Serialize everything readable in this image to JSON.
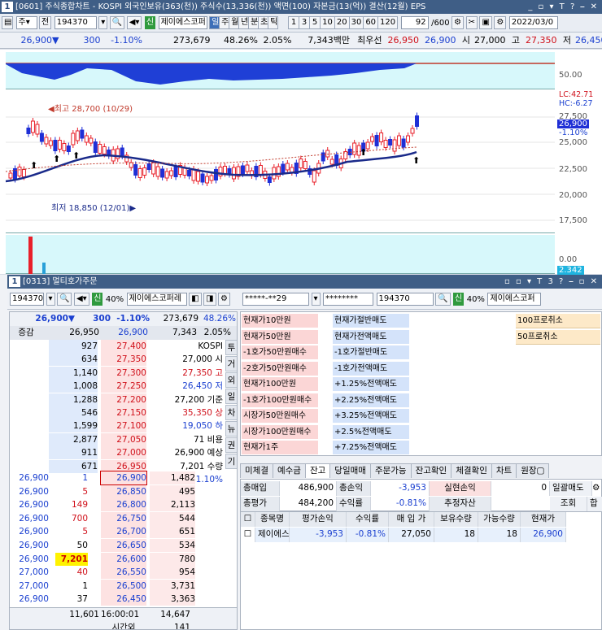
{
  "chart_window": {
    "num": "1",
    "title": "[0601] 주식종합차트 - KOSPI 외국인보유(363(천)) 주식수(13,336(천)) 액면(100) 자본금(13(억)) 결산(12월) EPS",
    "controls": "_ ▫ ▾ T ? ⎯ ✕"
  },
  "toolbar": {
    "mode": "주▾",
    "full": "전",
    "code": "194370",
    "green": "신",
    "name": "제이에스코퍼",
    "period_tabs": [
      "일",
      "주",
      "월",
      "년",
      "분",
      "초",
      "틱"
    ],
    "intervals": [
      "1",
      "3",
      "5",
      "10",
      "20",
      "30",
      "60",
      "120"
    ],
    "count": "92",
    "count_total": "/600",
    "date": "2022/03/0"
  },
  "quote": {
    "price": "26,900",
    "change": "300",
    "rate": "-1.10%",
    "volume": "273,679",
    "vol_rate": "48.26%",
    "turnover": "2.05%",
    "amount": "7,343백만",
    "best_label": "최우선",
    "bid": "26,950",
    "ask": "26,900",
    "open_label": "시",
    "open": "27,000",
    "high_label": "고",
    "high": "27,350",
    "low_label": "저",
    "low": "26,450",
    "sell_btn": "매수"
  },
  "chart_data": {
    "type": "candlestick",
    "upper_axis": [
      "50.00"
    ],
    "price_axis": [
      "27,500",
      "25,000",
      "22,500",
      "20,000",
      "17,500"
    ],
    "lower_axis": [
      "0.00",
      "2.342"
    ],
    "lc": "LC:42.71",
    "hc": "HC:-6.27",
    "last_price": "26,900",
    "last_rate": "-1.10%",
    "high_note": "최고 28,700 (10/29)",
    "low_note": "최저 18,850 (12/01)",
    "colors": {
      "up": "#e8202a",
      "down": "#1f2fd6",
      "ma": "#1a2a8a",
      "ma2": "#c0392b"
    }
  },
  "order_window": {
    "num": "1",
    "title": "[0313] 멀티호가주문",
    "controls": "▫ ▫ ▾ T 3 ? ⎯ ▫ ✕",
    "code": "194370",
    "green": "신",
    "margin": "40%",
    "name": "제이에스코퍼레",
    "account": "*****-**29",
    "password": "********",
    "code2": "194370",
    "green2": "신",
    "margin2": "40%",
    "name2": "제이에스코퍼"
  },
  "orderbook": {
    "price": "26,900▼",
    "change": "300",
    "rate": "-1.10%",
    "volume": "273,679",
    "vol_rate": "48.26%",
    "sub_label": "증감",
    "sub_bid": "26,950",
    "sub_ask": "26,900",
    "sub_amount": "7,343",
    "sub_rate": "2.05%",
    "sell_rows": [
      {
        "qty": "927",
        "price": "27,400",
        "info": "KOSPI"
      },
      {
        "qty": "634",
        "price": "27,350",
        "info": "27,000 시"
      },
      {
        "qty": "1,140",
        "price": "27,300",
        "info": "27,350 고"
      },
      {
        "qty": "1,008",
        "price": "27,250",
        "info": "26,450 저"
      },
      {
        "qty": "1,288",
        "price": "27,200",
        "info": "27,200 기준"
      },
      {
        "qty": "546",
        "price": "27,150",
        "info": "35,350 상"
      },
      {
        "qty": "1,599",
        "price": "27,100",
        "info": "19,050 하"
      },
      {
        "qty": "2,877",
        "price": "27,050",
        "info": "71 비용"
      },
      {
        "qty": "911",
        "price": "27,000",
        "info": "26,900 예상"
      },
      {
        "qty": "671",
        "price": "26,950",
        "info": "7,201 수량"
      }
    ],
    "expected_change": "▼300",
    "expected_rate": "-1.10%",
    "side_tabs": [
      "투",
      "거",
      "외",
      "일",
      "차",
      "뉴",
      "권",
      "기"
    ],
    "buy_rows": [
      {
        "trade_price": "26,900",
        "trade_qty": "1",
        "price": "26,900",
        "qty": "1,482"
      },
      {
        "trade_price": "26,900",
        "trade_qty": "5",
        "price": "26,850",
        "qty": "495"
      },
      {
        "trade_price": "26,900",
        "trade_qty": "149",
        "price": "26,800",
        "qty": "2,113"
      },
      {
        "trade_price": "26,900",
        "trade_qty": "700",
        "price": "26,750",
        "qty": "544"
      },
      {
        "trade_price": "26,900",
        "trade_qty": "5",
        "price": "26,700",
        "qty": "651"
      },
      {
        "trade_price": "26,900",
        "trade_qty": "50",
        "price": "26,650",
        "qty": "534"
      },
      {
        "trade_price": "26,900",
        "trade_qty": "7,201",
        "price": "26,600",
        "qty": "780"
      },
      {
        "trade_price": "27,000",
        "trade_qty": "40",
        "price": "26,550",
        "qty": "954"
      },
      {
        "trade_price": "27,000",
        "trade_qty": "1",
        "price": "26,500",
        "qty": "3,731"
      },
      {
        "trade_price": "26,900",
        "trade_qty": "37",
        "price": "26,450",
        "qty": "3,363"
      }
    ],
    "total_sell": "11,601",
    "time": "16:00:01",
    "total_buy": "14,647",
    "after_label": "시간외",
    "after_qty": "141"
  },
  "quick_buttons": {
    "col1": [
      "현재가10만원",
      "현재가50만원",
      "-1호가50만원매수",
      "-2호가50만원매수",
      "현재가100만원",
      "-1호가100만원매수",
      "시장가50만원매수",
      "시장가100만원매수",
      "현재가1주"
    ],
    "col2": [
      "현재가절반매도",
      "현재가전액매도",
      "-1호가절반매도",
      "-1호가전액매도",
      "+1.25%전액매도",
      "+2.25%전액매도",
      "+3.25%전액매도",
      "+2.5%전액매도",
      "+7.25%전액매도"
    ],
    "col4": [
      "100프로취소",
      "50프로취소"
    ]
  },
  "account_tabs": [
    "미체결",
    "예수금",
    "잔고",
    "당일매매",
    "주문가능",
    "잔고확인",
    "체결확인",
    "차트",
    "원장▢"
  ],
  "summary": {
    "buy_total_label": "총매입",
    "buy_total": "486,900",
    "pl_label": "총손익",
    "pl": "-3,953",
    "realized_label": "실현손익",
    "realized": "0",
    "bulk_sell": "일괄매도",
    "eval_label": "총평가",
    "eval": "484,200",
    "rate_label": "수익률",
    "rate": "-0.81%",
    "est_label": "추정자산",
    "query_btn": "조회",
    "sum_btn": "합"
  },
  "holdings": {
    "headers": [
      "종목명",
      "평가손익",
      "수익률",
      "매 입 가",
      "보유수량",
      "가능수량",
      "현재가"
    ],
    "rows": [
      {
        "name": "제이에스코",
        "pl": "-3,953",
        "rate": "-0.81%",
        "avg": "27,050",
        "hold": "18",
        "avail": "18",
        "price": "26,900"
      }
    ]
  }
}
